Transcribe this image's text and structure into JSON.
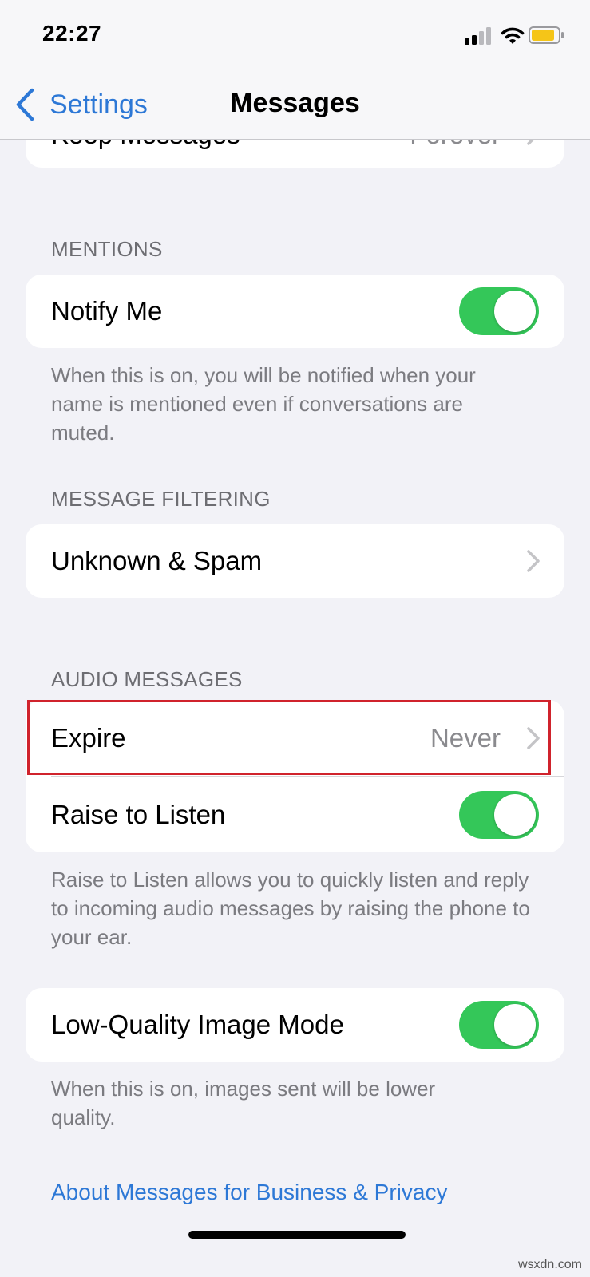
{
  "status_bar": {
    "time": "22:27"
  },
  "nav": {
    "back_label": "Settings",
    "title": "Messages"
  },
  "partial_row": {
    "label": "Keep Messages",
    "value": "Forever"
  },
  "mentions": {
    "header": "MENTIONS",
    "notify_me": {
      "label": "Notify Me",
      "on": true
    },
    "footnote": "When this is on, you will be notified when your name is mentioned even if conversations are muted."
  },
  "message_filtering": {
    "header": "MESSAGE FILTERING",
    "unknown_spam": {
      "label": "Unknown & Spam"
    }
  },
  "audio_messages": {
    "header": "AUDIO MESSAGES",
    "expire": {
      "label": "Expire",
      "value": "Never"
    },
    "raise_to_listen": {
      "label": "Raise to Listen",
      "on": true
    },
    "footnote": "Raise to Listen allows you to quickly listen and reply to incoming audio messages by raising the phone to your ear."
  },
  "low_quality": {
    "label": "Low-Quality Image Mode",
    "on": true,
    "footnote": "When this is on, images sent will be lower quality."
  },
  "about_link": "About Messages for Business & Privacy",
  "watermark": "wsxdn.com",
  "colors": {
    "accent": "#2d78d6",
    "toggle_on": "#34c759",
    "highlight": "#d0232c",
    "battery": "#f5c518"
  }
}
